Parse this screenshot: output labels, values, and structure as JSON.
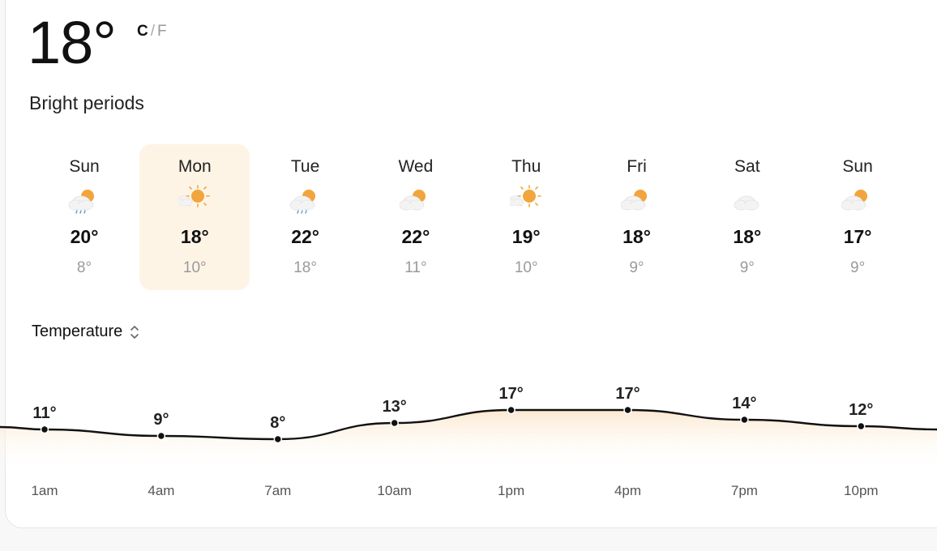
{
  "current": {
    "temperature": "18°",
    "unit_c": "C",
    "unit_sep": "/",
    "unit_f": "F",
    "condition": "Bright periods"
  },
  "days": [
    {
      "name": "Sun",
      "hi": "20°",
      "lo": "8°",
      "icon": "sun-cloud-rain-icon",
      "selected": false
    },
    {
      "name": "Mon",
      "hi": "18°",
      "lo": "10°",
      "icon": "sun-cloud-icon",
      "selected": true
    },
    {
      "name": "Tue",
      "hi": "22°",
      "lo": "18°",
      "icon": "sun-cloud-rain-icon",
      "selected": false
    },
    {
      "name": "Wed",
      "hi": "22°",
      "lo": "11°",
      "icon": "cloud-sun-icon",
      "selected": false
    },
    {
      "name": "Thu",
      "hi": "19°",
      "lo": "10°",
      "icon": "sun-cloud-icon",
      "selected": false
    },
    {
      "name": "Fri",
      "hi": "18°",
      "lo": "9°",
      "icon": "cloud-sun-icon",
      "selected": false
    },
    {
      "name": "Sat",
      "hi": "18°",
      "lo": "9°",
      "icon": "cloud-icon",
      "selected": false
    },
    {
      "name": "Sun",
      "hi": "17°",
      "lo": "9°",
      "icon": "cloud-sun-icon",
      "selected": false
    }
  ],
  "metric_selector": {
    "label": "Temperature"
  },
  "chart_data": {
    "type": "line",
    "x": [
      "1am",
      "4am",
      "7am",
      "10am",
      "1pm",
      "4pm",
      "7pm",
      "10pm"
    ],
    "values": [
      11,
      9,
      8,
      13,
      17,
      17,
      14,
      12
    ],
    "labels": [
      "11°",
      "9°",
      "8°",
      "13°",
      "17°",
      "17°",
      "14°",
      "12°"
    ],
    "ylim": [
      0,
      20
    ],
    "grid": false
  },
  "colors": {
    "selected_day_bg": "#fdf4e6",
    "sun": "#f2a53c",
    "cloud": "#f1f1f1",
    "rain": "#5a9fd6",
    "area_fill": "#fdf1e2"
  }
}
